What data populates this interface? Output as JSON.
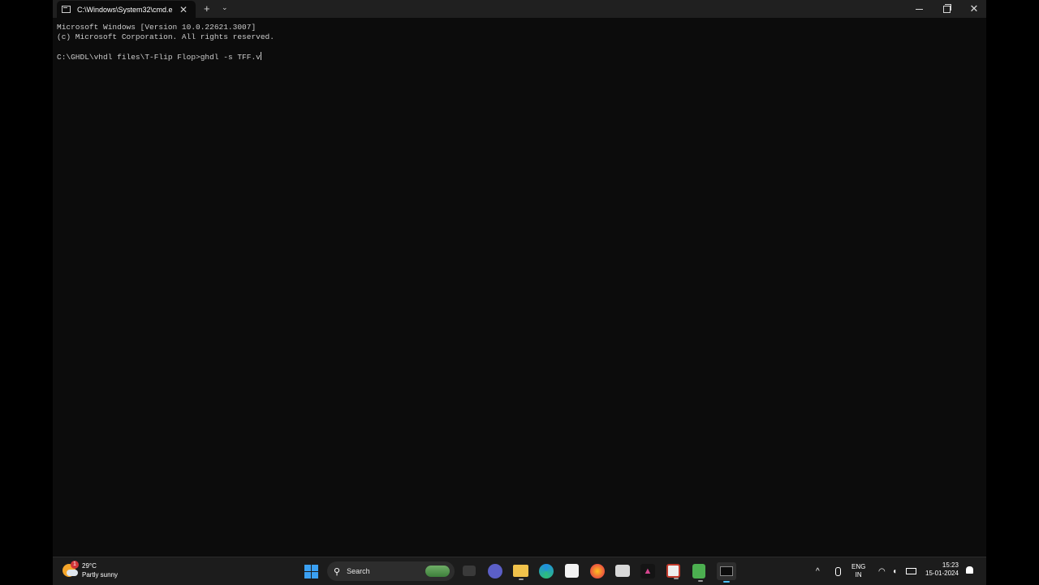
{
  "tab": {
    "title": "C:\\Windows\\System32\\cmd.e"
  },
  "console": {
    "line1": "Microsoft Windows [Version 10.0.22621.3007]",
    "line2": "(c) Microsoft Corporation. All rights reserved.",
    "prompt": "C:\\GHDL\\vhdl files\\T-Flip Flop>",
    "command": "ghdl -s TFF.v"
  },
  "weather": {
    "badge": "1",
    "temp": "29°C",
    "condition": "Partly sunny"
  },
  "search": {
    "label": "Search"
  },
  "tray": {
    "lang_top": "ENG",
    "lang_bottom": "IN",
    "time": "15:23",
    "date": "15-01-2024"
  },
  "colors": {
    "console_bg": "#0c0c0c",
    "titlebar": "#202020",
    "taskbar": "#1c1c1c",
    "start_blue": "#3aa0f3"
  }
}
